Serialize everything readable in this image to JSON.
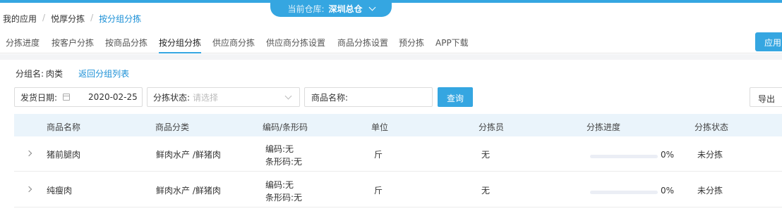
{
  "warehouse": {
    "label": "当前仓库:",
    "value": "深圳总仓"
  },
  "breadcrumb": [
    {
      "label": "我的应用"
    },
    {
      "label": "悦厚分拣"
    },
    {
      "label": "按分组分拣"
    }
  ],
  "tabs": [
    {
      "label": "分拣进度"
    },
    {
      "label": "按客户分拣"
    },
    {
      "label": "按商品分拣"
    },
    {
      "label": "按分组分拣",
      "active": true
    },
    {
      "label": "供应商分拣"
    },
    {
      "label": "供应商分拣设置"
    },
    {
      "label": "商品分拣设置"
    },
    {
      "label": "预分拣"
    },
    {
      "label": "APP下载"
    }
  ],
  "apply_button": "应用",
  "group": {
    "label": "分组名:",
    "value": "肉类",
    "back_link": "返回分组列表"
  },
  "filters": {
    "date_label": "发货日期:",
    "date_value": "2020-02-25",
    "status_label": "分拣状态:",
    "status_placeholder": "请选择",
    "name_label": "商品名称:",
    "name_value": ""
  },
  "query_button": "查询",
  "export_button": "导出",
  "table": {
    "headers": [
      "商品名称",
      "商品分类",
      "编码/条形码",
      "单位",
      "分拣员",
      "分拣进度",
      "分拣状态"
    ],
    "rows": [
      {
        "name": "猪前腿肉",
        "category": "鲜肉水产 /鲜猪肉",
        "code": "编码:无",
        "barcode": "条形码:无",
        "unit": "斤",
        "sorter": "无",
        "progress": 0,
        "progress_text": "0%",
        "status": "未分拣"
      },
      {
        "name": "纯瘦肉",
        "category": "鲜肉水产 /鲜猪肉",
        "code": "编码:无",
        "barcode": "条形码:无",
        "unit": "斤",
        "sorter": "无",
        "progress": 0,
        "progress_text": "0%",
        "status": "未分拣"
      }
    ]
  },
  "colors": {
    "accent": "#35a6e1",
    "link": "#1a8fd6",
    "header_bg": "#eaf4fb"
  }
}
